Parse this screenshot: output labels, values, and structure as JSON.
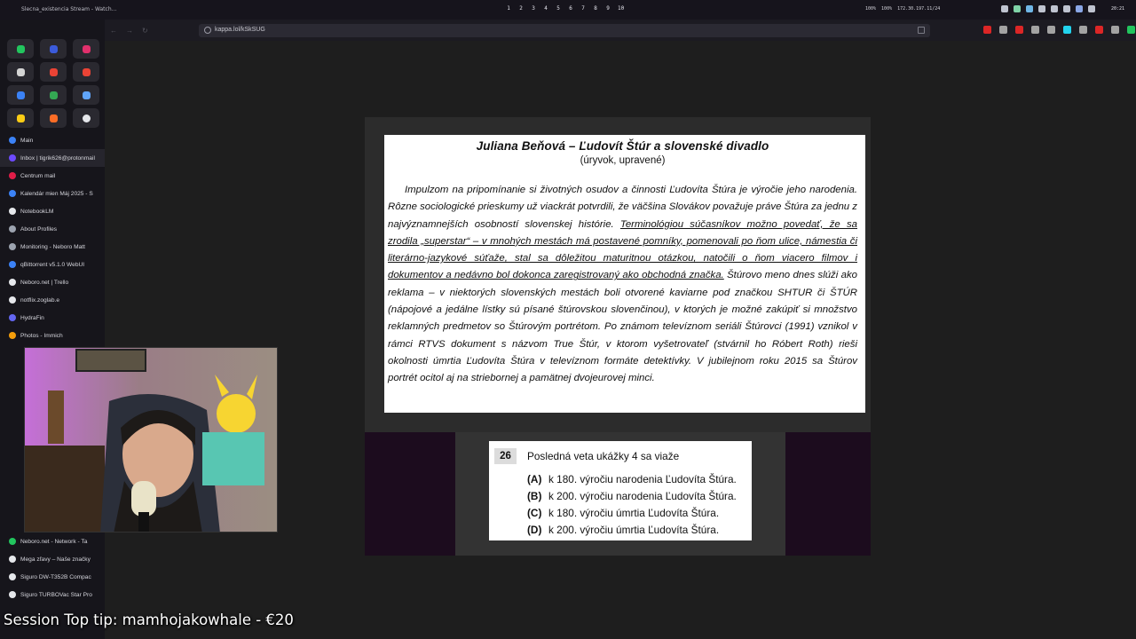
{
  "system_bar": {
    "window_title": "Slecna_existencia Stream - Watch...",
    "workspaces": [
      "1",
      "2",
      "3",
      "4",
      "5",
      "6",
      "7",
      "8",
      "9",
      "10"
    ],
    "status": [
      "100%",
      "100%",
      "172.30.197.11/24"
    ],
    "clock": "20:21"
  },
  "browser": {
    "url": "kappa.lol/kSkSUG"
  },
  "sidebar": {
    "tabs": [
      {
        "label": "Main",
        "color": "#3b82f6"
      },
      {
        "label": "Inbox | tigrik626@protonmail",
        "color": "#6d4aff"
      },
      {
        "label": "Centrum mail",
        "color": "#e11d48"
      },
      {
        "label": "Kalendár mien Máj 2025 - S",
        "color": "#3b82f6"
      },
      {
        "label": "NotebookLM",
        "color": "#e5e7eb"
      },
      {
        "label": "About Profiles",
        "color": "#9ca3af"
      },
      {
        "label": "Monitoring - Neboro Matt",
        "color": "#9ca3af"
      },
      {
        "label": "qBittorrent v5.1.0 WebUI",
        "color": "#3b82f6"
      },
      {
        "label": "Neboro.net | Trello",
        "color": "#e5e7eb"
      },
      {
        "label": "notflix.zoglab.e",
        "color": "#e5e7eb"
      },
      {
        "label": "HydraFin",
        "color": "#6366f1"
      },
      {
        "label": "Photos - Immich",
        "color": "#f59e0b"
      }
    ],
    "bottom_tabs": [
      {
        "label": "Neboro.net - Network - Ta",
        "color": "#22c55e"
      },
      {
        "label": "Mega zľavy – Naše značky",
        "color": "#e5e7eb"
      },
      {
        "label": "Sigurо DW-T352B Compac",
        "color": "#e5e7eb"
      },
      {
        "label": "Sigurо TURBOVac Star Pro",
        "color": "#e5e7eb"
      }
    ]
  },
  "document": {
    "title": "Juliana Beňová – Ľudovít Štúr a slovenské divadlo",
    "subtitle": "(úryvok, upravené)",
    "para_part1": "Impulzom na pripomínanie si životných osudov a činnosti Ľudovíta Štúra je výročie jeho narodenia. Rôzne sociologické prieskumy už viackrát potvrdili, že väčšina Slovákov považuje práve Štúra za jednu z najvýznamnejších osobností slovenskej histórie. ",
    "para_underlined": "Terminológiou súčasníkov možno povedať, že sa zrodila „superstar“ – v mnohých mestách má postavené pomníky, pomenovali po ňom ulice, námestia či literárno-jazykové súťaže, stal sa dôležitou maturitnou otázkou, natočili o ňom viacero filmov i dokumentov a nedávno bol dokonca zaregistrovaný ako obchodná značka.",
    "para_part2": " Štúrovo meno dnes slúži ako reklama – v niektorých slovenských mestách boli otvorené kaviarne pod značkou SHTUR či ŠTÚR (nápojové a jedálne lístky sú písané štúrovskou slovenčinou), v ktorých je možné zakúpiť si množstvo reklamných predmetov so Štúrovým portrétom. Po známom televíznom seriáli Štúrovci (1991) vznikol v rámci RTVS dokument s názvom True Štúr, v ktorom vyšetrovateľ (stvárnil ho Róbert Roth) rieši okolnosti úmrtia Ľudovíta Štúra v televíznom formáte detektívky. V jubilejnom roku 2015 sa Štúrov portrét ocitol aj na striebornej a pamätnej dvojeurovej minci."
  },
  "question": {
    "number": "26",
    "text": "Posledná veta ukážky 4 sa viaže",
    "options": [
      {
        "key": "(A)",
        "text": "k 180. výročiu narodenia Ľudovíta Štúra."
      },
      {
        "key": "(B)",
        "text": "k 200. výročiu narodenia Ľudovíta Štúra."
      },
      {
        "key": "(C)",
        "text": "k 180. výročiu úmrtia Ľudovíta Štúra."
      },
      {
        "key": "(D)",
        "text": "k 200. výročiu úmrtia Ľudovíta Štúra."
      }
    ]
  },
  "overlay": {
    "tip": "Session Top tip: mamhojakowhale - €20"
  }
}
